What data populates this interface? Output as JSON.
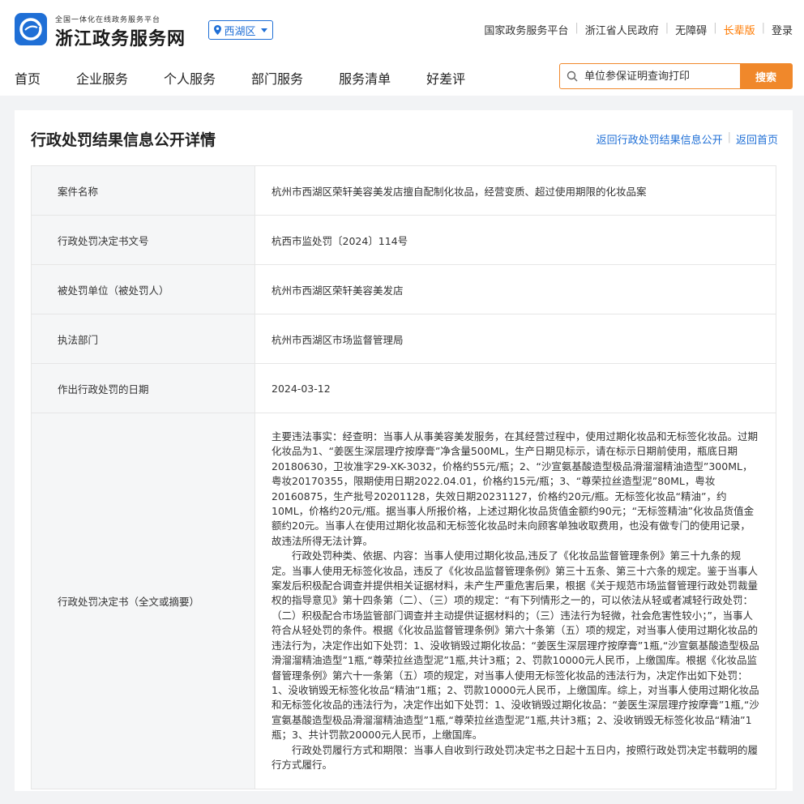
{
  "header": {
    "logo_small": "全国一体化在线政务服务平台",
    "logo_big": "浙江政务服务网",
    "region": "西湖区",
    "links": [
      "国家政务服务平台",
      "浙江省人民政府",
      "无障碍",
      "长辈版",
      "登录"
    ],
    "nav": [
      "首页",
      "企业服务",
      "个人服务",
      "部门服务",
      "服务清单",
      "好差评"
    ],
    "search_placeholder": "单位参保证明查询打印",
    "search_button": "搜索"
  },
  "panel": {
    "title": "行政处罚结果信息公开详情",
    "link_back_list": "返回行政处罚结果信息公开",
    "link_home": "返回首页"
  },
  "rows": [
    {
      "label": "案件名称",
      "value": "杭州市西湖区荣轩美容美发店擅自配制化妆品，经营变质、超过使用期限的化妆品案"
    },
    {
      "label": "行政处罚决定书文号",
      "value": "杭西市监处罚〔2024〕114号"
    },
    {
      "label": "被处罚单位（被处罚人）",
      "value": "杭州市西湖区荣轩美容美发店"
    },
    {
      "label": "执法部门",
      "value": "杭州市西湖区市场监督管理局"
    },
    {
      "label": "作出行政处罚的日期",
      "value": "2024-03-12"
    }
  ],
  "decision": {
    "label": "行政处罚决定书（全文或摘要）",
    "p1": "主要违法事实：经查明：当事人从事美容美发服务，在其经营过程中，使用过期化妆品和无标签化妆品。过期化妆品为1、“姜医生深层理疗按摩膏”净含量500ML，生产日期见标示，请在标示日期前使用，瓶底日期20180630，卫妆准字29-XK-3032，价格约55元/瓶；2、“沙宣氨基酸造型极品滑溜溜精油造型”300ML，粤妆20170355，限期使用日期2022.04.01，价格约15元/瓶；3、“尊荣拉丝造型泥”80ML，粤妆20160875，生产批号20201128，失效日期20231127，价格约20元/瓶。无标签化妆品“精油”，约10ML，价格约20元/瓶。据当事人所报价格，上述过期化妆品货值金额约90元；“无标签精油”化妆品货值金额约20元。当事人在使用过期化妆品和无标签化妆品时未向顾客单独收取费用，也没有做专门的使用记录，故违法所得无法计算。",
    "p2": "行政处罚种类、依据、内容：当事人使用过期化妆品,违反了《化妆品监督管理条例》第三十九条的规定。当事人使用无标签化妆品，违反了《化妆品监督管理条例》第三十五条、第三十六条的规定。鉴于当事人案发后积极配合调查并提供相关证据材料，未产生严重危害后果，根据《关于规范市场监督管理行政处罚裁量权的指导意见》第十四条第（二）、（三）项的规定：“有下列情形之一的，可以依法从轻或者减轻行政处罚：（二）积极配合市场监管部门调查并主动提供证据材料的；（三）违法行为轻微，社会危害性较小；”，当事人符合从轻处罚的条件。根据《化妆品监督管理条例》第六十条第（五）项的规定，对当事人使用过期化妆品的违法行为，决定作出如下处罚：1、没收销毁过期化妆品：“姜医生深层理疗按摩膏”1瓶,“沙宣氨基酸造型极品滑溜溜精油造型”1瓶,“尊荣拉丝造型泥”1瓶,共计3瓶；2、罚款10000元人民币，上缴国库。根据《化妆品监督管理条例》第六十一条第（五）项的规定，对当事人使用无标签化妆品的违法行为，决定作出如下处罚：1、没收销毁无标签化妆品“精油”1瓶；2、罚款10000元人民币，上缴国库。综上，对当事人使用过期化妆品和无标签化妆品的违法行为，决定作出如下处罚：1、没收销毁过期化妆品：“姜医生深层理疗按摩膏”1瓶,“沙宣氨基酸造型极品滑溜溜精油造型”1瓶,“尊荣拉丝造型泥”1瓶,共计3瓶；2、没收销毁无标签化妆品“精油”1瓶；3、共计罚款20000元人民币，上缴国库。",
    "p3": "行政处罚履行方式和期限：当事人自收到行政处罚决定书之日起十五日内，按照行政处罚决定书载明的履行方式履行。"
  }
}
